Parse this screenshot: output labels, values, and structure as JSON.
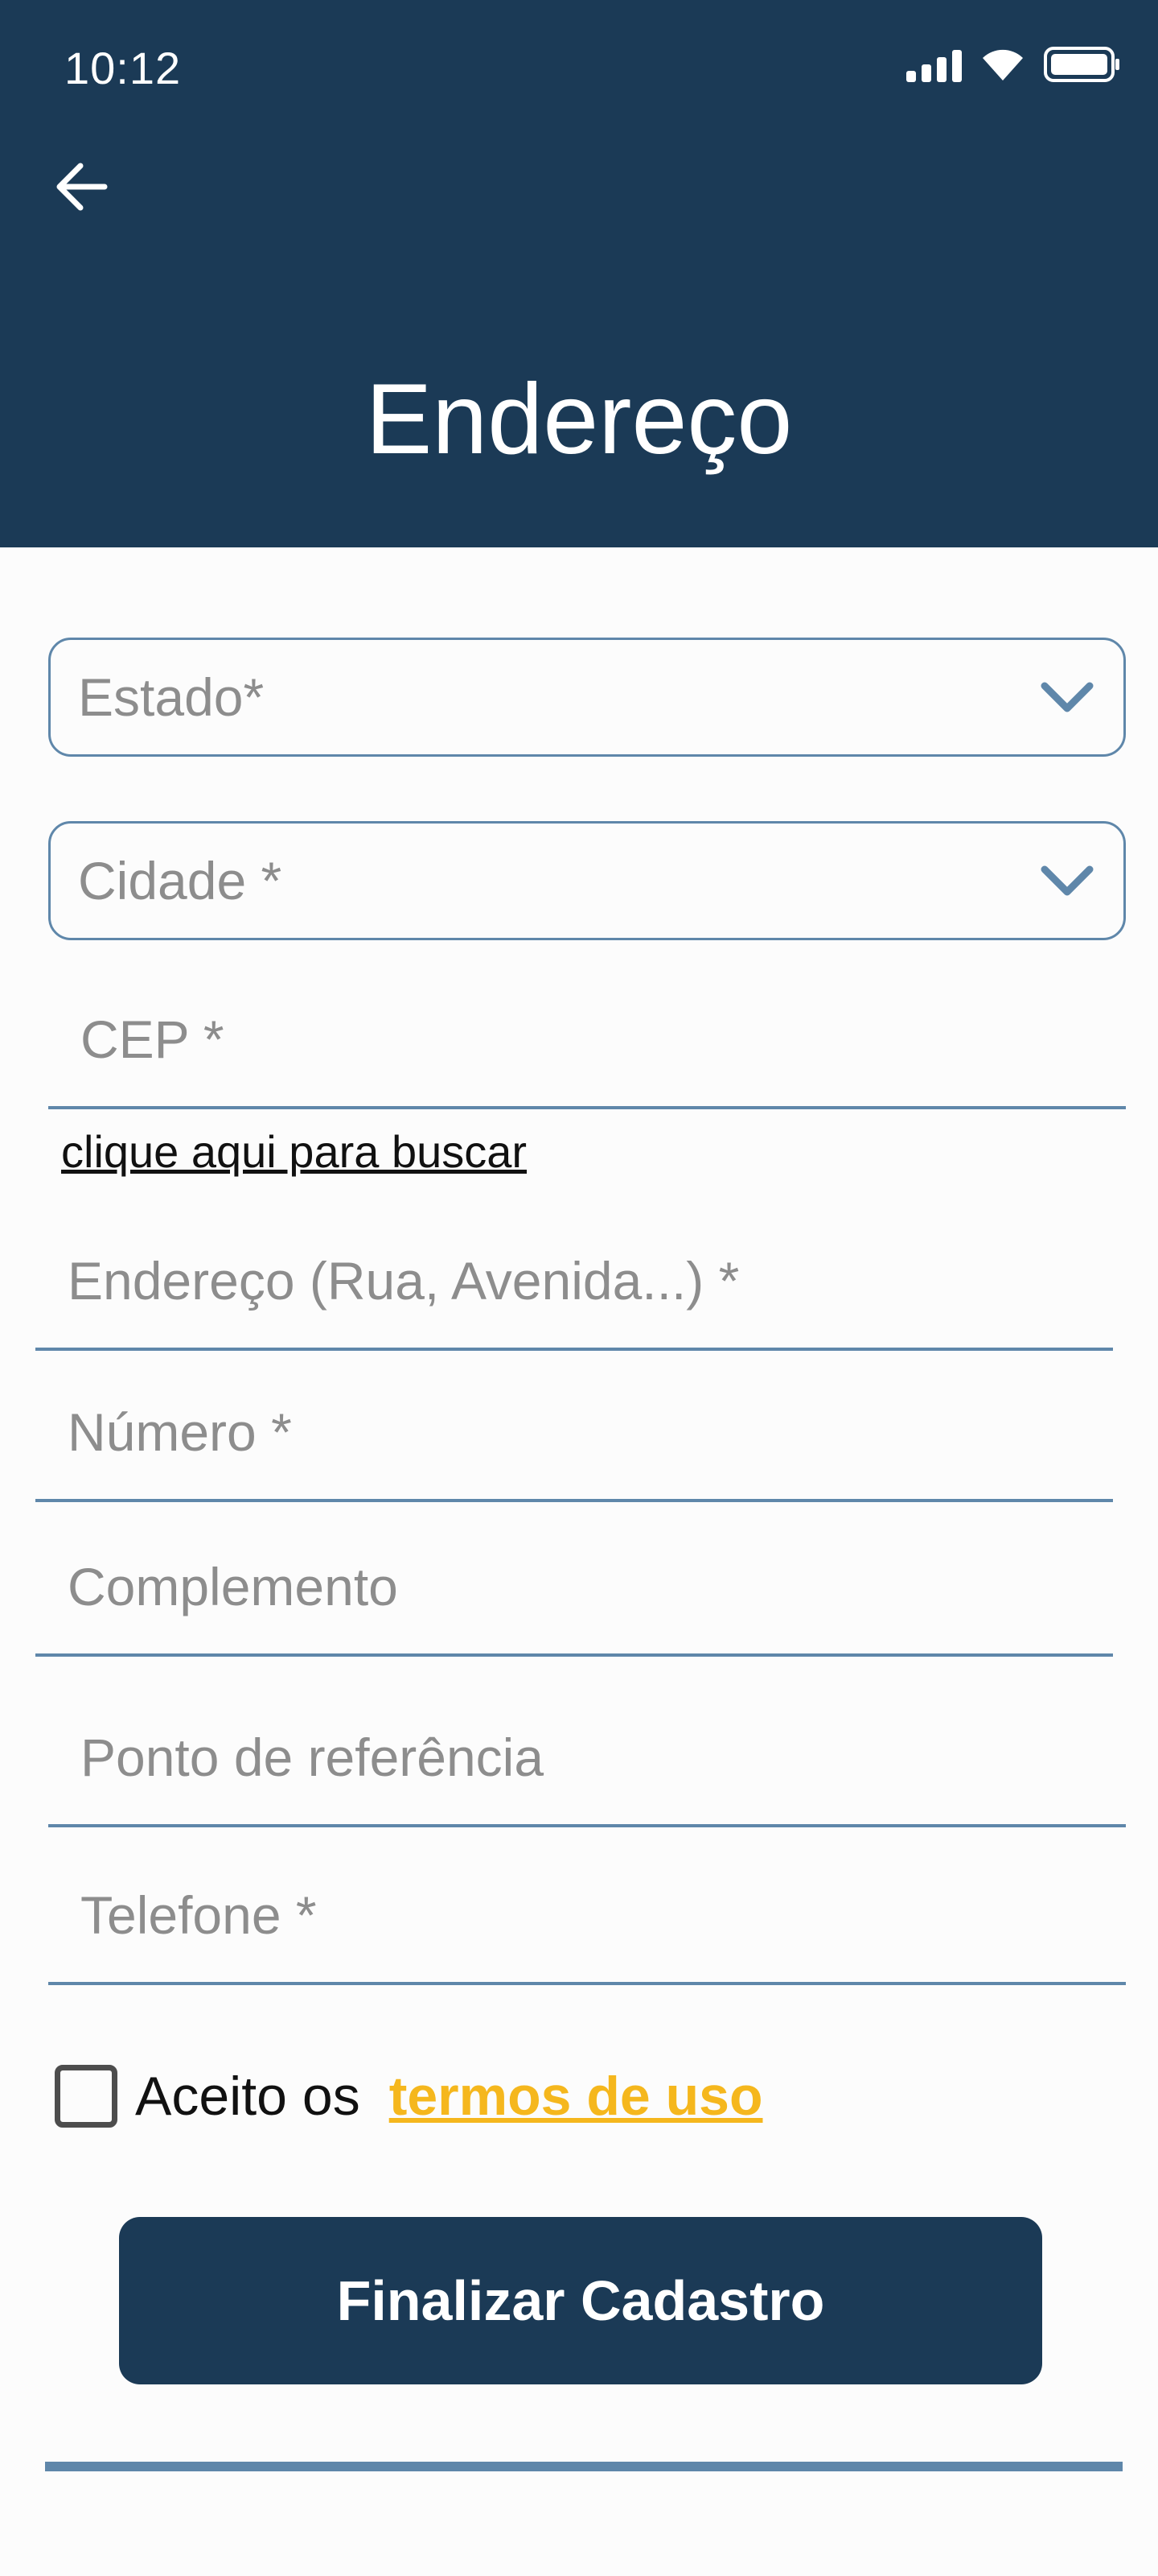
{
  "status_bar": {
    "time": "10:12"
  },
  "header": {
    "title": "Endereço"
  },
  "form": {
    "state": {
      "placeholder": "Estado*"
    },
    "city": {
      "placeholder": "Cidade *"
    },
    "cep": {
      "placeholder": "CEP *",
      "search_link": "clique aqui para buscar"
    },
    "address": {
      "placeholder": "Endereço (Rua, Avenida...) *"
    },
    "number": {
      "placeholder": "Número *"
    },
    "complement": {
      "placeholder": "Complemento"
    },
    "reference": {
      "placeholder": "Ponto de referência"
    },
    "phone": {
      "placeholder": "Telefone *"
    },
    "terms": {
      "text": "Aceito os",
      "link": "termos de uso",
      "checked": false
    },
    "submit_label": "Finalizar Cadastro"
  },
  "colors": {
    "primary": "#1b3a56",
    "accent": "#5f87aa",
    "link": "#f5b71d"
  },
  "icons": [
    "back-arrow-icon",
    "signal-icon",
    "wifi-icon",
    "battery-icon",
    "chevron-down-icon"
  ]
}
